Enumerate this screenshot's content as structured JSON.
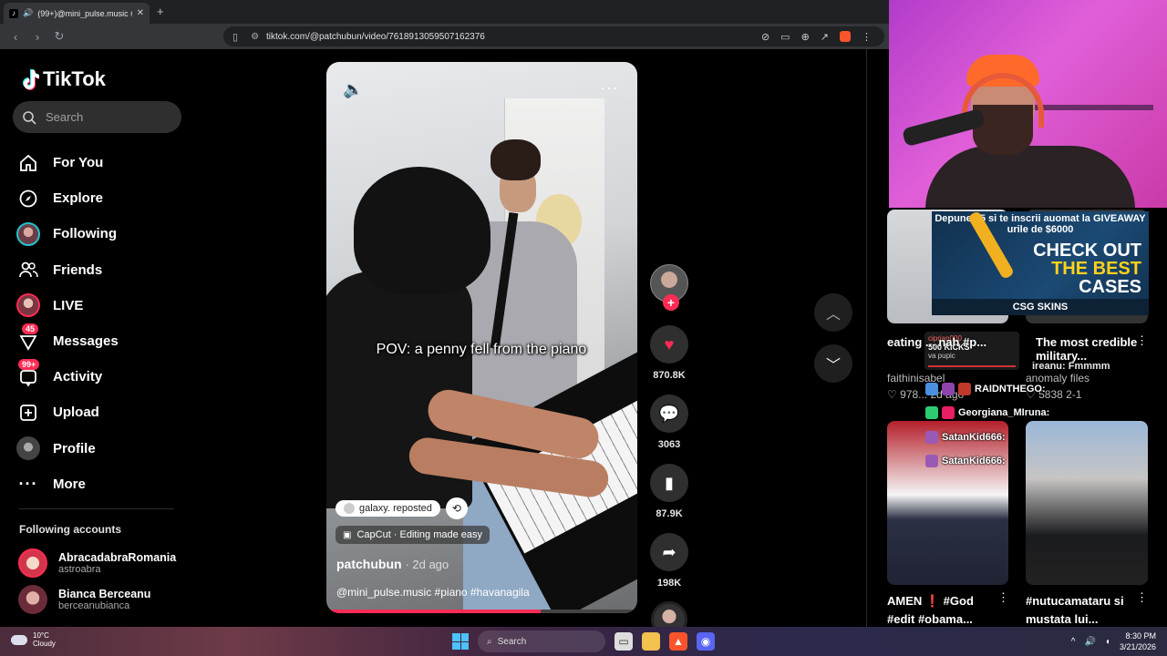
{
  "browser": {
    "tab_title": "(99+)@mini_pulse.music #piano",
    "tab_favicon": "tiktok-icon",
    "url": "tiktok.com/@patchubun/video/7618913059507162376"
  },
  "sidebar": {
    "brand": "TikTok",
    "search_placeholder": "Search",
    "nav": [
      {
        "label": "For You",
        "icon": "home-icon"
      },
      {
        "label": "Explore",
        "icon": "compass-icon"
      },
      {
        "label": "Following",
        "icon": "avatar"
      },
      {
        "label": "Friends",
        "icon": "friends-icon"
      },
      {
        "label": "LIVE",
        "icon": "avatar"
      },
      {
        "label": "Messages",
        "icon": "messages-icon",
        "badge": "45"
      },
      {
        "label": "Activity",
        "icon": "activity-icon",
        "badge": "99+"
      },
      {
        "label": "Upload",
        "icon": "plus-square-icon"
      },
      {
        "label": "Profile",
        "icon": "avatar"
      },
      {
        "label": "More",
        "icon": "more-icon"
      }
    ],
    "following_title": "Following accounts",
    "accounts": [
      {
        "name": "AbracadabraRomania",
        "username": "astroabra"
      },
      {
        "name": "Bianca Berceanu",
        "username": "berceanubianca"
      }
    ]
  },
  "video": {
    "caption": "POV: a penny fell from the piano",
    "repost_label": "galaxy. reposted",
    "capcut_label": "CapCut · Editing made easy",
    "author": "patchubun",
    "posted": "· 2d ago",
    "description": "@mini_pulse.music #piano #havanagila",
    "progress": 0.69
  },
  "actions": {
    "likes": "870.8K",
    "comments": "3063",
    "saves": "87.9K",
    "shares": "198K"
  },
  "overlay": {
    "ad_line": "Depune $5 si te inscrii auomat la GIVEAWAY urile de $6000",
    "ad_amount1": "$5",
    "ad_amount2": "$6000",
    "ad_big1": "CHECK OUT",
    "ad_big2": "THE BEST",
    "ad_big3": "CASES",
    "ad_brand": "CSG SKINS",
    "kicks_user": "ciprian000",
    "kicks_count": "500 KICKS",
    "kicks_sub": "va pupic",
    "feed1_title": "eating ... nah #p...",
    "feed1_user": "faithinisabel",
    "feed1_likes": "978...",
    "feed1_date": "2d ago",
    "feed2_title": "The most credible military...",
    "feed2_user": "anomaly files",
    "feed2_likes": "5838",
    "feed2_date": "2-1",
    "chat1": "RAIDNTHEGO:",
    "chat2": "Georgiana_MIruna:",
    "chat3": "SatanKid666:",
    "chat4": "SatanKid666:",
    "chat_fm": "ireanu: Fmmmm",
    "feed3_title": "AMEN ❗ #God #edit #obama...",
    "feed4_title": "#nutucamataru si mustata lui..."
  },
  "taskbar": {
    "temp": "10°C",
    "condition": "Cloudy",
    "search": "Search",
    "time": "8:30 PM",
    "date": "3/21/2026"
  }
}
